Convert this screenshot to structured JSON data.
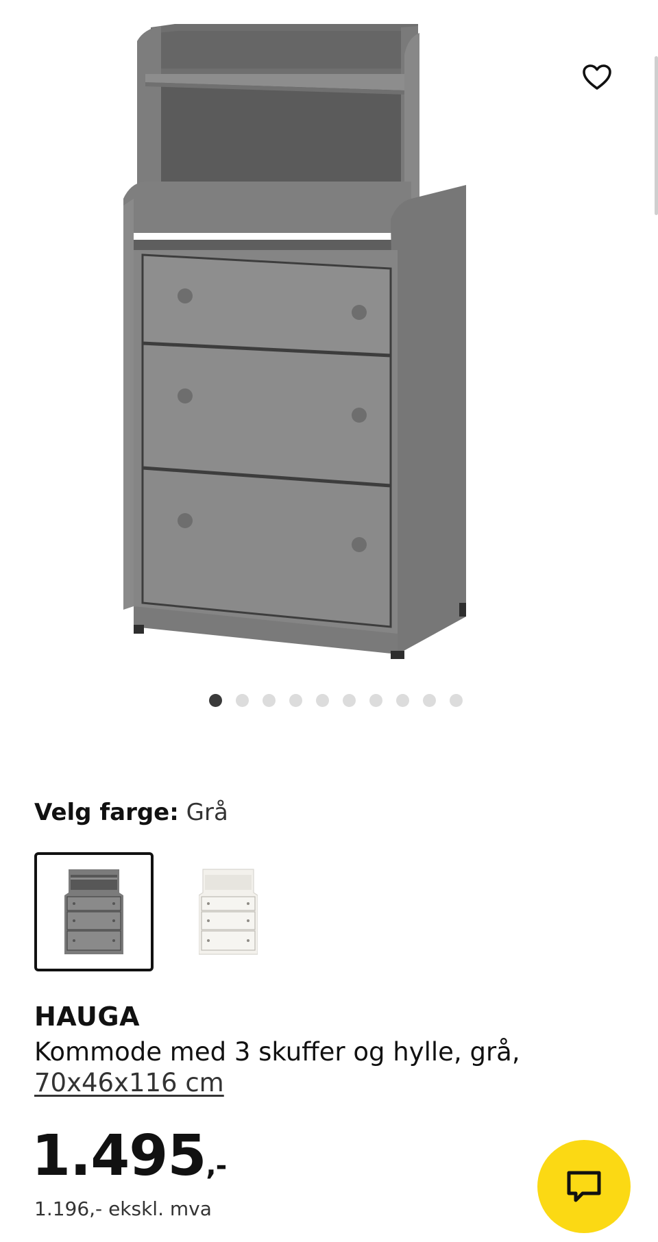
{
  "gallery": {
    "image_alt": "HAUGA kommode med 3 skuffer og hylle, grå",
    "dot_count": 10,
    "active_index": 0,
    "icons": {
      "favorite": "heart-outline-icon"
    }
  },
  "color_picker": {
    "label": "Velg farge:",
    "value": "Grå",
    "options": [
      {
        "name": "Grå",
        "selected": true,
        "color": "#7b7b7b"
      },
      {
        "name": "Hvit",
        "selected": false,
        "color": "#f3f1ec"
      }
    ]
  },
  "product": {
    "name": "HAUGA",
    "description": "Kommode med 3 skuffer og hylle, grå,",
    "dimensions": "70x46x116 cm"
  },
  "price": {
    "amount": "1.495",
    "suffix": ",-",
    "ex_vat": "1.196,- ekskl. mva"
  },
  "chat": {
    "icon": "chat-bubble-icon",
    "color": "#fbd914"
  }
}
